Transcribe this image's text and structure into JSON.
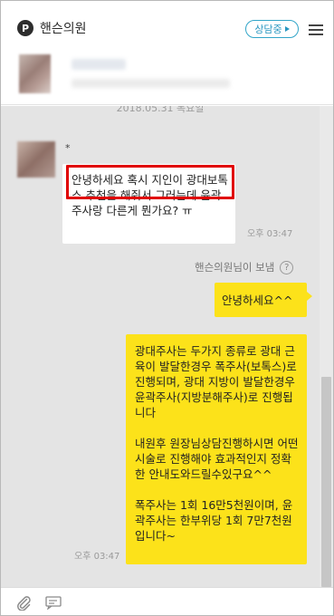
{
  "header": {
    "brand_logo": "P",
    "clinic_name": "핸슨의원",
    "status_label": "상담중",
    "menu_icon": "hamburger-icon"
  },
  "chat": {
    "date_separator": "2018.05.31 목요일",
    "incoming": {
      "sender_name": "*",
      "text": "안녕하세요 혹시 지인이 광대보톡스 추천을 해줘서 그러는데 윤곽주사랑 다른게 뭔가요? ㅠ",
      "time": "오후 03:47"
    },
    "sent_by_label": "핸슨의원님이 보냄",
    "outgoing": [
      {
        "text": "안녕하세요^^"
      },
      {
        "text": "광대주사는 두가지 종류로 광대 근육이 발달한경우 폭주사(보톡스)로 진행되며, 광대 지방이 발달한경우 윤곽주사(지방분해주사)로 진행됩니다\n\n내원후 원장님상담진행하시면 어떤시술로 진행해야 효과적인지 정확한 안내도와드릴수있구요^^\n\n폭주사는 1회 16만5천원이며, 윤곽주사는 한부위당 1회 7만7천원입니다~",
        "time": "오후 03:47"
      }
    ]
  },
  "footer": {
    "attach_icon": "paperclip-icon",
    "message_icon": "chat-card-icon"
  },
  "colors": {
    "chat_background": "#e4e4e4",
    "outgoing_bubble": "#fce21a",
    "incoming_bubble": "#ffffff",
    "status_accent": "#2796c0",
    "highlight": "#e00000"
  }
}
